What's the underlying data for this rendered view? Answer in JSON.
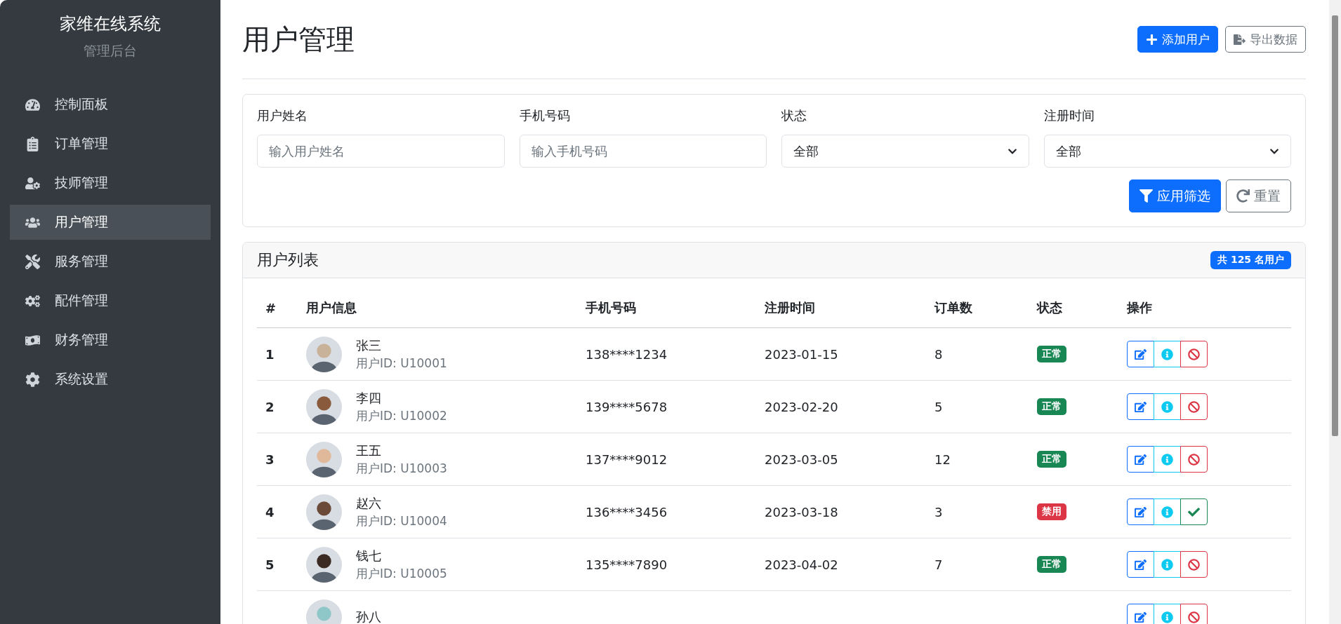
{
  "sidebar": {
    "title": "家维在线系统",
    "subtitle": "管理后台",
    "items": [
      {
        "label": "控制面板",
        "kind": "dashboard",
        "selected": false
      },
      {
        "label": "订单管理",
        "kind": "clipboard",
        "selected": false
      },
      {
        "label": "技师管理",
        "kind": "technician",
        "selected": false
      },
      {
        "label": "用户管理",
        "kind": "users",
        "selected": true
      },
      {
        "label": "服务管理",
        "kind": "tools",
        "selected": false
      },
      {
        "label": "配件管理",
        "kind": "parts",
        "selected": false
      },
      {
        "label": "财务管理",
        "kind": "finance",
        "selected": false
      },
      {
        "label": "系统设置",
        "kind": "settings",
        "selected": false
      }
    ]
  },
  "page": {
    "title": "用户管理",
    "buttons": [
      {
        "label": "添加用户",
        "kind": "primary"
      },
      {
        "label": "导出数据",
        "kind": "export"
      }
    ]
  },
  "filters": {
    "fields": [
      {
        "label": "用户姓名",
        "kind": "text",
        "placeholder": "输入用户姓名"
      },
      {
        "label": "手机号码",
        "kind": "text",
        "placeholder": "输入手机号码"
      },
      {
        "label": "状态",
        "kind": "select",
        "value": "全部"
      },
      {
        "label": "注册时间",
        "kind": "select",
        "value": "全部"
      }
    ],
    "buttons": [
      {
        "label": "应用筛选",
        "kind": "filter"
      },
      {
        "label": "重置",
        "kind": "reset"
      }
    ]
  },
  "table": {
    "title": "用户列表",
    "count": "共 125 名用户",
    "columns": [
      "#",
      "用户信息",
      "手机号码",
      "注册时间",
      "订单数",
      "状态",
      "操作"
    ],
    "rows": [
      {
        "index": "1",
        "name": "张三",
        "user_id": "用户ID: U10001",
        "phone": "138****1234",
        "registered": "2023-01-15",
        "orders": "8",
        "status": {
          "label": "正常",
          "color": "#198754"
        },
        "actions": [
          {
            "kind": "edit"
          },
          {
            "kind": "info"
          },
          {
            "kind": "ban"
          }
        ]
      },
      {
        "index": "2",
        "name": "李四",
        "user_id": "用户ID: U10002",
        "phone": "139****5678",
        "registered": "2023-02-20",
        "orders": "5",
        "status": {
          "label": "正常",
          "color": "#198754"
        },
        "actions": [
          {
            "kind": "edit"
          },
          {
            "kind": "info"
          },
          {
            "kind": "ban"
          }
        ]
      },
      {
        "index": "3",
        "name": "王五",
        "user_id": "用户ID: U10003",
        "phone": "137****9012",
        "registered": "2023-03-05",
        "orders": "12",
        "status": {
          "label": "正常",
          "color": "#198754"
        },
        "actions": [
          {
            "kind": "edit"
          },
          {
            "kind": "info"
          },
          {
            "kind": "ban"
          }
        ]
      },
      {
        "index": "4",
        "name": "赵六",
        "user_id": "用户ID: U10004",
        "phone": "136****3456",
        "registered": "2023-03-18",
        "orders": "3",
        "status": {
          "label": "禁用",
          "color": "#dc3545"
        },
        "actions": [
          {
            "kind": "edit"
          },
          {
            "kind": "info"
          },
          {
            "kind": "enable"
          }
        ]
      },
      {
        "index": "5",
        "name": "钱七",
        "user_id": "用户ID: U10005",
        "phone": "135****7890",
        "registered": "2023-04-02",
        "orders": "7",
        "status": {
          "label": "正常",
          "color": "#198754"
        },
        "actions": [
          {
            "kind": "edit"
          },
          {
            "kind": "info"
          },
          {
            "kind": "ban"
          }
        ]
      },
      {
        "name": "孙八",
        "actions": [
          {
            "kind": "edit"
          },
          {
            "kind": "info"
          },
          {
            "kind": "ban"
          }
        ]
      }
    ]
  }
}
